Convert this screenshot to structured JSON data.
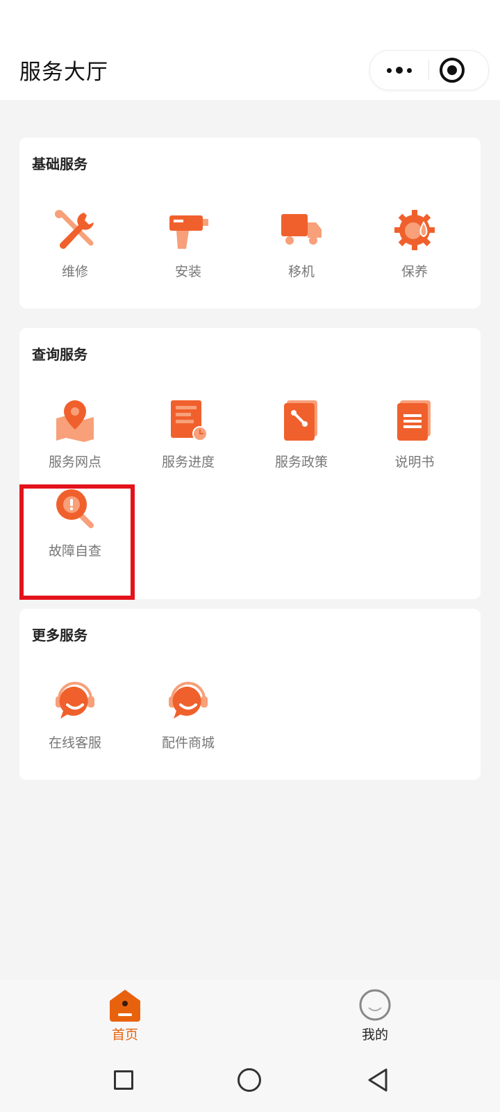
{
  "header": {
    "title": "服务大厅"
  },
  "colors": {
    "accent": "#f0602c",
    "accent_light": "#f7a07a",
    "highlight": "#e3131b"
  },
  "sections": [
    {
      "title": "基础服务",
      "items": [
        {
          "label": "维修",
          "icon": "wrench-screwdriver-icon"
        },
        {
          "label": "安装",
          "icon": "drill-icon"
        },
        {
          "label": "移机",
          "icon": "truck-icon"
        },
        {
          "label": "保养",
          "icon": "gear-drop-icon"
        }
      ]
    },
    {
      "title": "查询服务",
      "items": [
        {
          "label": "服务网点",
          "icon": "map-pin-icon"
        },
        {
          "label": "服务进度",
          "icon": "progress-clock-icon"
        },
        {
          "label": "服务政策",
          "icon": "policy-book-icon"
        },
        {
          "label": "说明书",
          "icon": "manual-icon"
        },
        {
          "label": "故障自查",
          "icon": "fault-search-icon"
        }
      ]
    },
    {
      "title": "更多服务",
      "items": [
        {
          "label": "在线客服",
          "icon": "customer-service-icon"
        },
        {
          "label": "配件商城",
          "icon": "customer-service-icon"
        }
      ]
    }
  ],
  "tabbar": {
    "home": {
      "label": "首页",
      "icon": "home-icon",
      "active": true
    },
    "mine": {
      "label": "我的",
      "icon": "profile-icon",
      "active": false
    }
  }
}
